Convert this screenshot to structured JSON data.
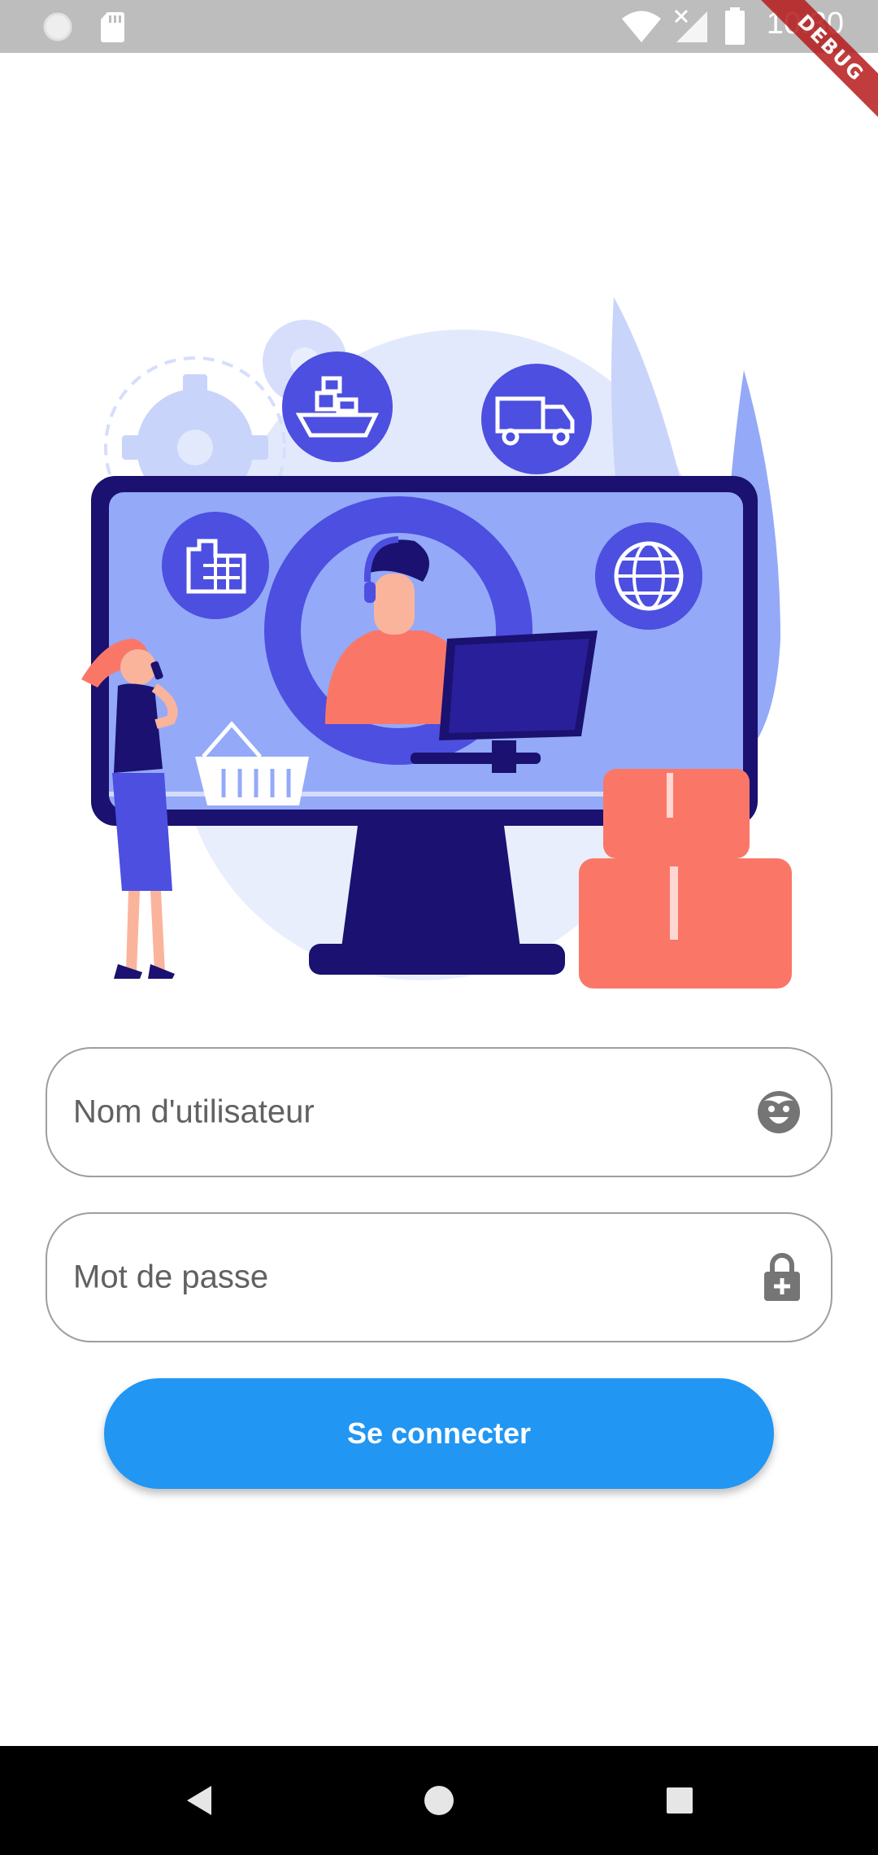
{
  "status_bar": {
    "time": "10:30",
    "icons": [
      "circle-icon",
      "sd-card-icon",
      "wifi-icon",
      "no-signal-icon",
      "battery-icon"
    ]
  },
  "debug_banner": {
    "label": "DEBUG"
  },
  "illustration": {
    "name": "logistics-customer-support-illustration",
    "colors": {
      "primary_dark": "#1a1170",
      "primary": "#4c4fe0",
      "light": "#94a9f8",
      "pale": "#e3e9fd",
      "coral": "#fa7768"
    }
  },
  "login_form": {
    "username": {
      "placeholder": "Nom d'utilisateur",
      "icon": "face-icon"
    },
    "password": {
      "placeholder": "Mot de passe",
      "icon": "lock-plus-icon"
    },
    "submit_label": "Se connecter"
  },
  "nav_bar": {
    "buttons": [
      "back-icon",
      "home-icon",
      "recents-icon"
    ]
  },
  "colors": {
    "accent": "#2196f3",
    "field_border": "#9e9e9e",
    "status_bar": "#bdbdbd"
  }
}
